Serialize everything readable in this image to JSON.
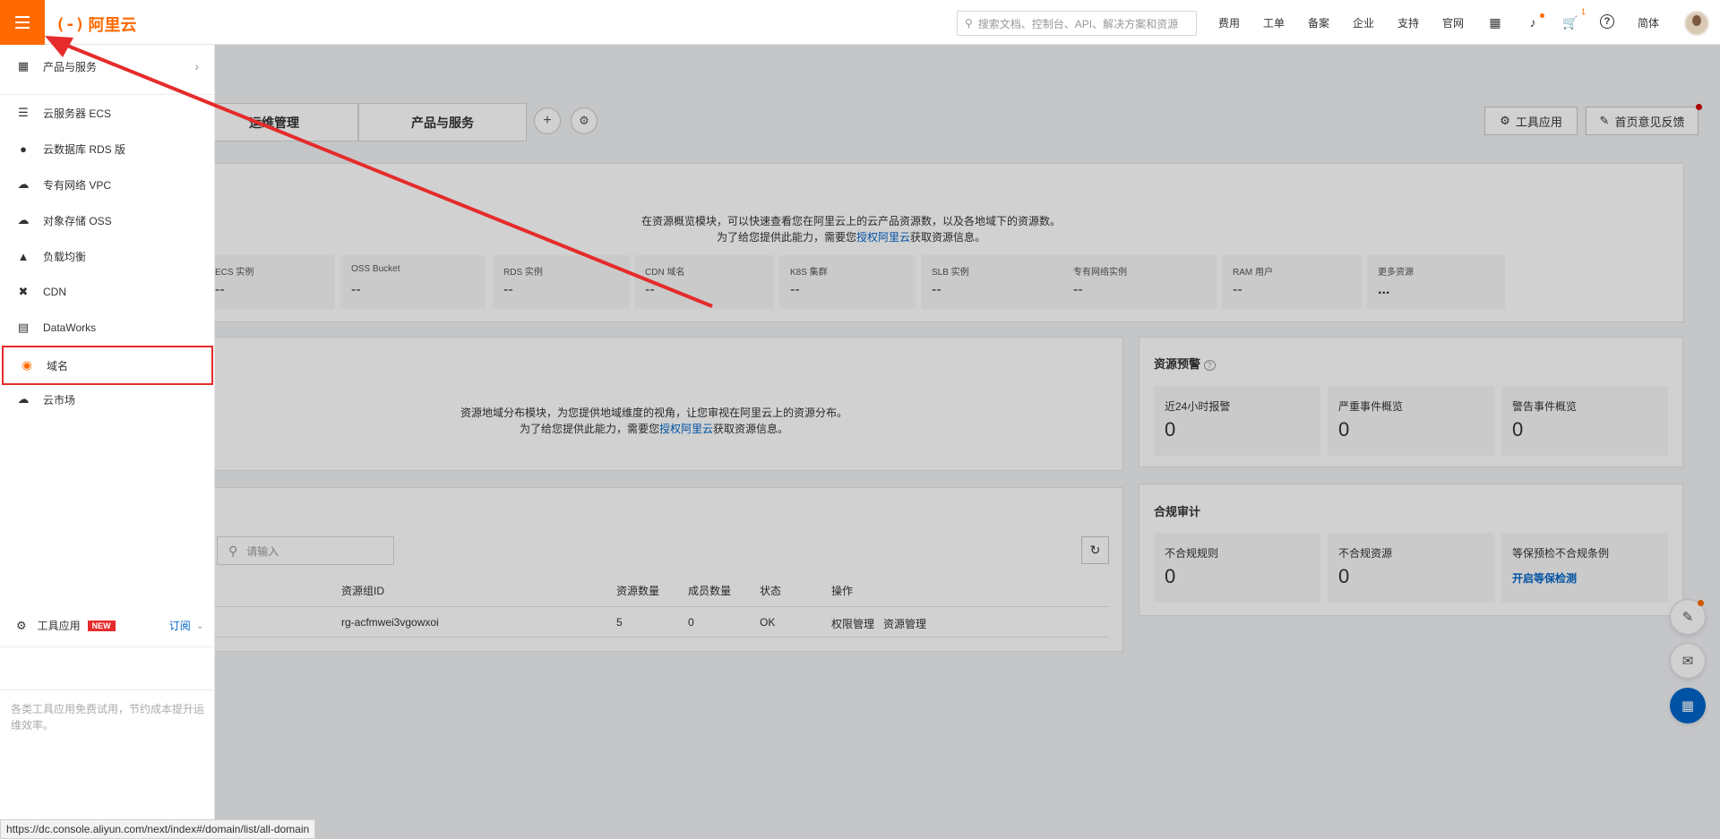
{
  "header": {
    "logo_text": "阿里云",
    "search_placeholder": "搜索文档、控制台、API、解决方案和资源",
    "nav": [
      "费用",
      "工单",
      "备案",
      "企业",
      "支持",
      "官网"
    ],
    "cart_badge": "1",
    "lang": "简体"
  },
  "tabs": [
    "运维管理",
    "产品与服务"
  ],
  "toolbar": {
    "tool_app": "工具应用",
    "feedback": "首页意见反馈"
  },
  "overview": {
    "line1": "在资源概览模块，可以快速查看您在阿里云上的云产品资源数，以及各地域下的资源数。",
    "line2_prefix": "为了给您提供此能力，需要您",
    "line2_link": "授权阿里云",
    "line2_suffix": "获取资源信息。",
    "cards": [
      {
        "label": "ECS 实例",
        "value": "--"
      },
      {
        "label": "OSS Bucket",
        "value": "--"
      },
      {
        "label": "RDS 实例",
        "value": "--"
      },
      {
        "label": "CDN 域名",
        "value": "--"
      },
      {
        "label": "K8S 集群",
        "value": "--"
      },
      {
        "label": "SLB 实例",
        "value": "--"
      },
      {
        "label": "专有网络实例",
        "value": "--"
      },
      {
        "label": "RAM 用户",
        "value": "--"
      },
      {
        "label": "更多资源",
        "value": "..."
      }
    ]
  },
  "region": {
    "line1": "资源地域分布模块，为您提供地域维度的视角，让您审视在阿里云上的资源分布。",
    "line2_prefix": "为了给您提供此能力，需要您",
    "line2_link": "授权阿里云",
    "line2_suffix": "获取资源信息。"
  },
  "alerts": {
    "title": "资源预警",
    "cards": [
      {
        "label": "近24小时报警",
        "value": "0"
      },
      {
        "label": "严重事件概览",
        "value": "0"
      },
      {
        "label": "警告事件概览",
        "value": "0"
      }
    ]
  },
  "compliance": {
    "title": "合规审计",
    "cards": [
      {
        "label": "不合规规则",
        "value": "0"
      },
      {
        "label": "不合规资源",
        "value": "0"
      },
      {
        "label": "等保预检不合规条例",
        "link": "开启等保检测"
      }
    ]
  },
  "resource_groups": {
    "search_placeholder": "请输入",
    "headers": [
      "资源组ID",
      "资源数量",
      "成员数量",
      "状态",
      "操作"
    ],
    "rows": [
      {
        "id": "rg-acfmwei3vgowxoi",
        "resources": "5",
        "members": "0",
        "status": "OK",
        "action1": "权限管理",
        "action2": "资源管理"
      }
    ]
  },
  "drawer": {
    "top_item": "产品与服务",
    "items": [
      {
        "icon": "server-icon",
        "label": "云服务器 ECS"
      },
      {
        "icon": "database-icon",
        "label": "云数据库 RDS 版"
      },
      {
        "icon": "cloud-network-icon",
        "label": "专有网络 VPC"
      },
      {
        "icon": "cloud-storage-icon",
        "label": "对象存储 OSS"
      },
      {
        "icon": "load-balance-icon",
        "label": "负载均衡"
      },
      {
        "icon": "cdn-icon",
        "label": "CDN"
      },
      {
        "icon": "dataworks-icon",
        "label": "DataWorks"
      },
      {
        "icon": "globe-icon",
        "label": "域名"
      },
      {
        "icon": "market-icon",
        "label": "云市场"
      }
    ],
    "footer_title": "工具应用",
    "footer_badge": "NEW",
    "footer_subscribe": "订阅",
    "footer_desc": "各类工具应用免费试用，节约成本提升运维效率。"
  },
  "status_url": "https://dc.console.aliyun.com/next/index#/domain/list/all-domain",
  "colors": {
    "brand": "#ff6a00",
    "link": "#0064c8",
    "highlight": "#e52b2b"
  }
}
